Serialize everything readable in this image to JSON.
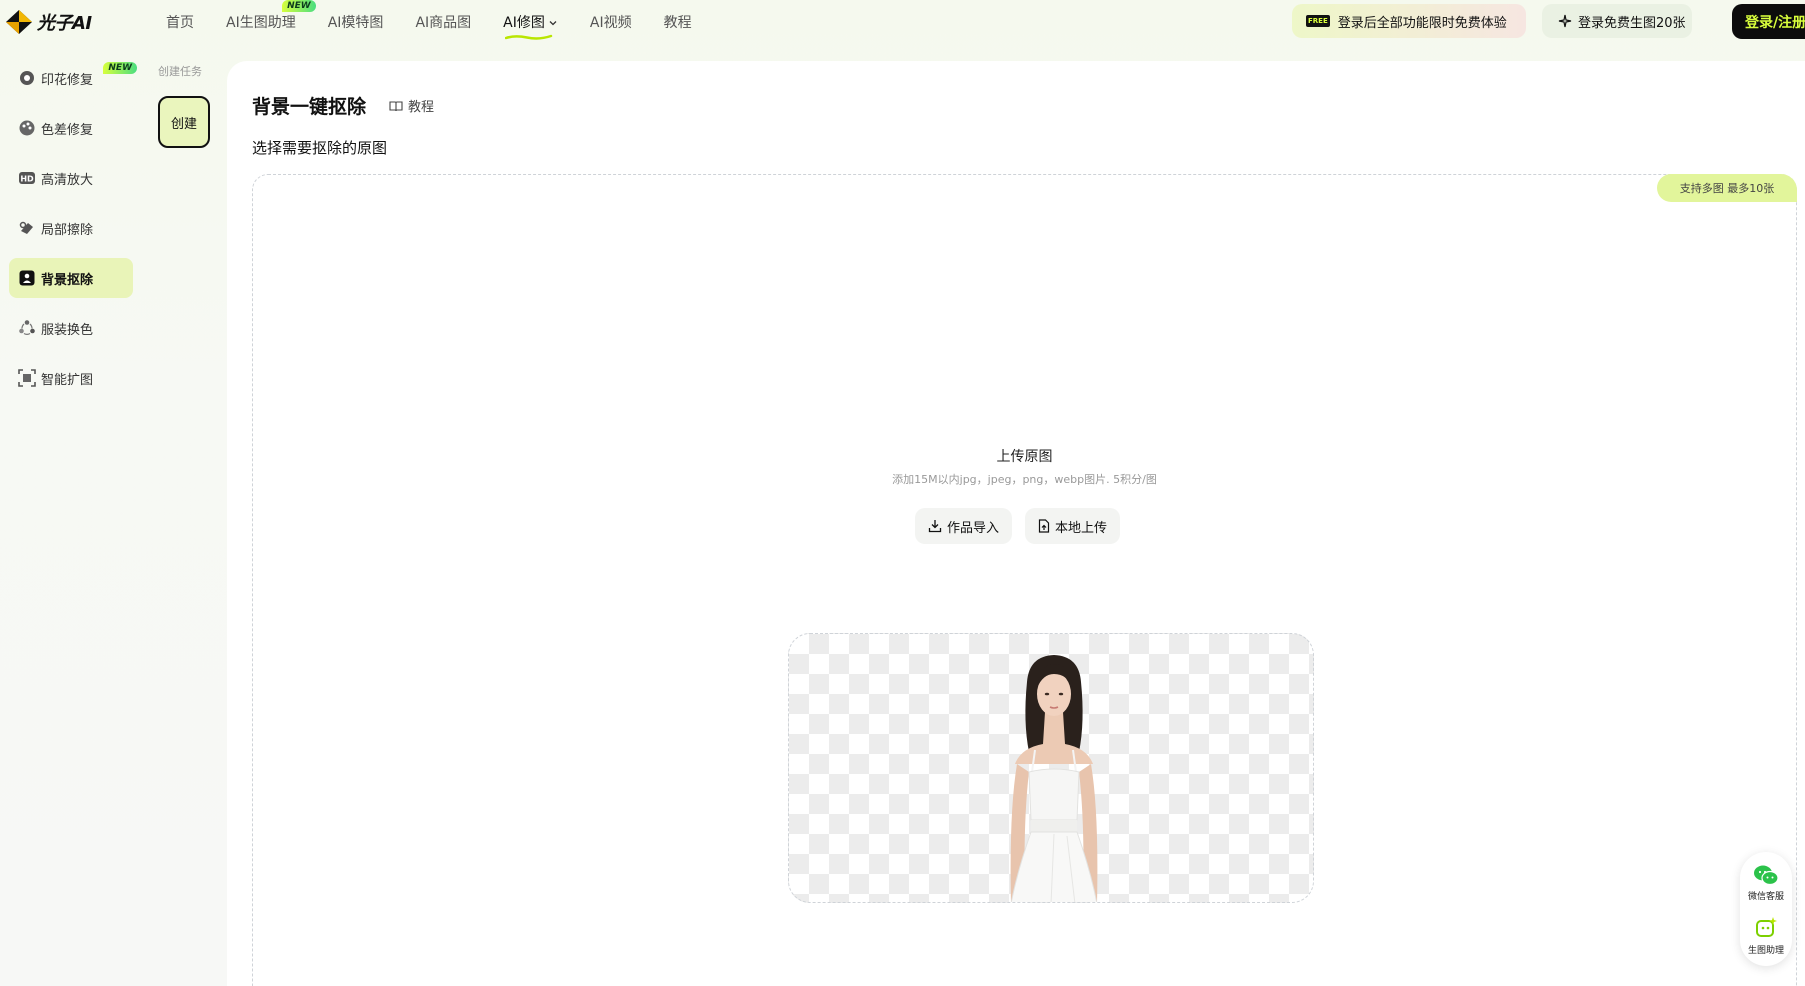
{
  "app": {
    "logo_text": "光子AI"
  },
  "nav": {
    "items": [
      {
        "label": "首页"
      },
      {
        "label": "AI生图助理",
        "badge": "NEW"
      },
      {
        "label": "AI模特图"
      },
      {
        "label": "AI商品图"
      },
      {
        "label": "AI修图",
        "active": true
      },
      {
        "label": "AI视频"
      },
      {
        "label": "教程"
      }
    ]
  },
  "header": {
    "free_badge": "FREE",
    "promo_trial": "登录后全部功能限时免费体验",
    "promo_free": "登录免费生图20张",
    "login_label": "登录/注册"
  },
  "sidebar": {
    "items": [
      {
        "label": "印花修复",
        "badge": "NEW",
        "icon": "print-repair-icon"
      },
      {
        "label": "色差修复",
        "icon": "palette-icon"
      },
      {
        "label": "高清放大",
        "icon": "hd-icon"
      },
      {
        "label": "局部擦除",
        "icon": "eraser-icon"
      },
      {
        "label": "背景抠除",
        "icon": "background-remove-icon",
        "active": true
      },
      {
        "label": "服装换色",
        "icon": "recolor-icon"
      },
      {
        "label": "智能扩图",
        "icon": "expand-icon"
      }
    ]
  },
  "tasks": {
    "label": "创建任务",
    "create_label": "创建"
  },
  "main": {
    "title": "背景一键抠除",
    "tutorial_label": "教程",
    "subtitle": "选择需要抠除的原图",
    "multi_tag": "支持多图 最多10张",
    "upload_title": "上传原图",
    "upload_hint": "添加15M以内jpg，jpeg，png，webp图片. 5积分/图",
    "import_label": "作品导入",
    "local_upload_label": "本地上传",
    "example_title": "背景一键抠除"
  },
  "floating": {
    "wechat_label": "微信客服",
    "assistant_label": "生图助理"
  },
  "colors": {
    "accent_lime": "#d9ff3c",
    "active_bg": "#e9f4b8",
    "dark": "#0c0c0c"
  }
}
